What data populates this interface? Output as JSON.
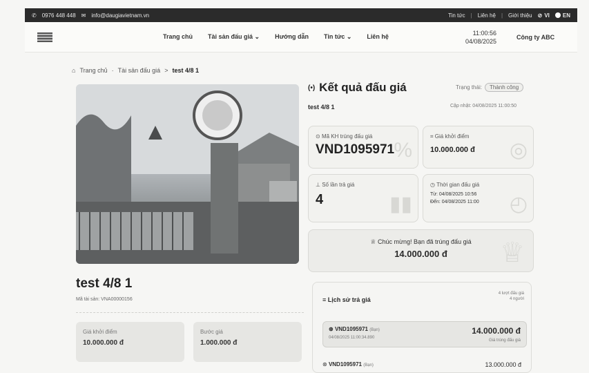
{
  "topbar": {
    "phone": "0976 448 448",
    "email": "info@daugiavietnam.vn",
    "links": [
      "Tin tức",
      "Liên hệ",
      "Giới thiệu"
    ],
    "lang_vi": "VI",
    "lang_en": "EN"
  },
  "nav": {
    "menu": [
      "Trang chủ",
      "Tài sản đấu giá ⌄",
      "Hướng dẫn",
      "Tin tức ⌄",
      "Liên hệ"
    ],
    "time": "11:00:56",
    "date": "04/08/2025",
    "company": "Công ty ABC"
  },
  "breadcrumb": {
    "home": "Trang chủ",
    "sep1": "·",
    "section": "Tài sản đấu giá",
    "sep2": ">",
    "current": "test 4/8 1"
  },
  "asset": {
    "title": "test 4/8 1",
    "code": "Mã tài sản: VNA00000156",
    "start_price_label": "Giá khởi điểm",
    "start_price": "10.000.000 đ",
    "step_label": "Bước giá",
    "step": "1.000.000 đ"
  },
  "result": {
    "icon": "(•)",
    "heading": "Kết quả đấu giá",
    "status_label": "Trạng thái:",
    "status": "Thành công",
    "subtitle": "test 4/8 1",
    "updated": "Cập nhật: 04/08/2025 11:00:50",
    "winner_code_label": "Mã KH trúng đấu giá",
    "winner_code": "VND1095971",
    "start_price_label": "Giá khởi điểm",
    "start_price": "10.000.000 đ",
    "bid_count_label": "Số lần trả giá",
    "bid_count": "4",
    "time_label": "Thời gian đấu giá",
    "time_from": "Từ: 04/08/2025 10:56",
    "time_to": "Đến: 04/08/2025 11:00",
    "congrats": "Chúc mừng! Bạn đã trúng đấu giá",
    "win_amount": "14.000.000 đ"
  },
  "history": {
    "title": "Lịch sử trả giá",
    "meta1": "4 lượt đấu giá",
    "meta2": "4 người",
    "rows": [
      {
        "uid": "VND1095971",
        "tag": "(Bạn)",
        "time": "04/08/2025 11:00:34.890",
        "amount": "14.000.000 đ",
        "note": "Giá trúng đấu giá"
      },
      {
        "uid": "VND1095971",
        "tag": "(Bạn)",
        "amount": "13.000.000 đ"
      }
    ]
  }
}
